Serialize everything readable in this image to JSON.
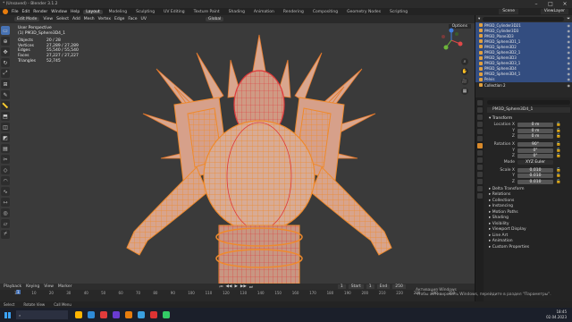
{
  "window": {
    "title": "* (Unsaved) - Blender 3.1.2"
  },
  "menu": [
    "File",
    "Edit",
    "Render",
    "Window",
    "Help"
  ],
  "workspaces": [
    "Layout",
    "Modeling",
    "Sculpting",
    "UV Editing",
    "Texture Paint",
    "Shading",
    "Animation",
    "Rendering",
    "Compositing",
    "Geometry Nodes",
    "Scripting"
  ],
  "active_workspace": "Layout",
  "scene": "Scene",
  "view_layer": "ViewLayer",
  "viewport": {
    "mode": "Edit Mode",
    "menus": [
      "View",
      "Select",
      "Add",
      "Mesh",
      "Vertex",
      "Edge",
      "Face",
      "UV"
    ],
    "transform_orientation": "Global",
    "options": "Options",
    "view_name": "User Perspective",
    "object_label": "(1) PM3D_Sphere3D4_1",
    "stats": [
      {
        "k": "Objects",
        "v": "20 / 28"
      },
      {
        "k": "Vertices",
        "v": "27,289 / 27,289"
      },
      {
        "k": "Edges",
        "v": "55,540 / 55,540"
      },
      {
        "k": "Faces",
        "v": "27,227 / 27,227"
      },
      {
        "k": "Triangles",
        "v": "52,745"
      }
    ]
  },
  "timeline": {
    "menus": [
      "Playback",
      "Keying",
      "View",
      "Marker"
    ],
    "start_label": "Start",
    "start": "1",
    "end_label": "End",
    "end": "250",
    "current": "1",
    "ticks": [
      "1",
      "10",
      "20",
      "30",
      "40",
      "50",
      "60",
      "70",
      "80",
      "90",
      "100",
      "110",
      "120",
      "130",
      "140",
      "150",
      "160",
      "170",
      "180",
      "190",
      "200",
      "210",
      "220",
      "230",
      "240",
      "250"
    ]
  },
  "outliner": {
    "rows": [
      {
        "name": "PM3D_Cylinder3D21",
        "sel": true
      },
      {
        "name": "PM3D_Cylinder3D3",
        "sel": true
      },
      {
        "name": "PM3D_Plane3D3",
        "sel": true
      },
      {
        "name": "PM3D_Sphere3D1_1",
        "sel": true
      },
      {
        "name": "PM3D_Sphere3D2",
        "sel": true
      },
      {
        "name": "PM3D_Sphere3D2_1",
        "sel": true
      },
      {
        "name": "PM3D_Sphere3D3",
        "sel": true
      },
      {
        "name": "PM3D_Sphere3D3_1",
        "sel": true
      },
      {
        "name": "PM3D_Sphere3D4",
        "sel": true
      },
      {
        "name": "PM3D_Sphere3D4_1",
        "sel": true
      },
      {
        "name": "Pelvis",
        "sel": true
      },
      {
        "name": "Collection 2",
        "sel": false
      }
    ]
  },
  "properties": {
    "object_name": "PM3D_Sphere3D4_1",
    "transform_title": "Transform",
    "location_label": "Location X",
    "location": [
      "0 m",
      "0 m",
      "0 m"
    ],
    "rotation_label": "Rotation X",
    "rotation": [
      "90°",
      "0°",
      "0°"
    ],
    "mode_label": "Mode",
    "mode": "XYZ Euler",
    "scale_label": "Scale X",
    "scale": [
      "0.010",
      "0.010",
      "0.010"
    ],
    "y_label": "Y",
    "z_label": "Z",
    "sections": [
      "Delta Transform",
      "Relations",
      "Collections",
      "Instancing",
      "Motion Paths",
      "Shading",
      "Visibility",
      "Viewport Display",
      "Line Art",
      "Animation",
      "Custom Properties"
    ]
  },
  "status": [
    "Select",
    "Rotate View",
    "Call Menu"
  ],
  "watermark": {
    "line1": "Активация Windows",
    "line2": "Чтобы активировать Windows, перейдите в раздел \"Параметры\"."
  },
  "taskbar": {
    "search_placeholder": "",
    "time": "18:45",
    "date": "02.04.2023"
  },
  "colors": {
    "accent": "#4772b3",
    "mesh_orange": "#e8882a",
    "mesh_red": "#e0393a",
    "body": "#c8a08a"
  }
}
